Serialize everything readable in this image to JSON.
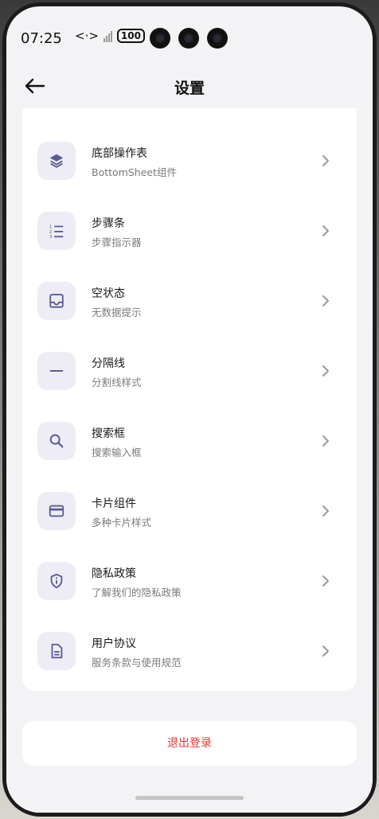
{
  "status": {
    "time": "07:25",
    "battery": "100"
  },
  "header": {
    "title": "设置"
  },
  "items": [
    {
      "title": "底部操作表",
      "subtitle": "BottomSheet组件",
      "icon": "layers-icon"
    },
    {
      "title": "步骤条",
      "subtitle": "步骤指示器",
      "icon": "numbered-list-icon"
    },
    {
      "title": "空状态",
      "subtitle": "无数据提示",
      "icon": "inbox-icon"
    },
    {
      "title": "分隔线",
      "subtitle": "分割线样式",
      "icon": "minus-icon"
    },
    {
      "title": "搜索框",
      "subtitle": "搜索输入框",
      "icon": "search-icon"
    },
    {
      "title": "卡片组件",
      "subtitle": "多种卡片样式",
      "icon": "credit-card-icon"
    },
    {
      "title": "隐私政策",
      "subtitle": "了解我们的隐私政策",
      "icon": "shield-info-icon"
    },
    {
      "title": "用户协议",
      "subtitle": "服务条款与使用规范",
      "icon": "document-icon"
    }
  ],
  "logout": {
    "label": "退出登录"
  },
  "colors": {
    "accent": "#5b5b94",
    "danger": "#e53935",
    "icon_bg": "#eeedf5"
  }
}
